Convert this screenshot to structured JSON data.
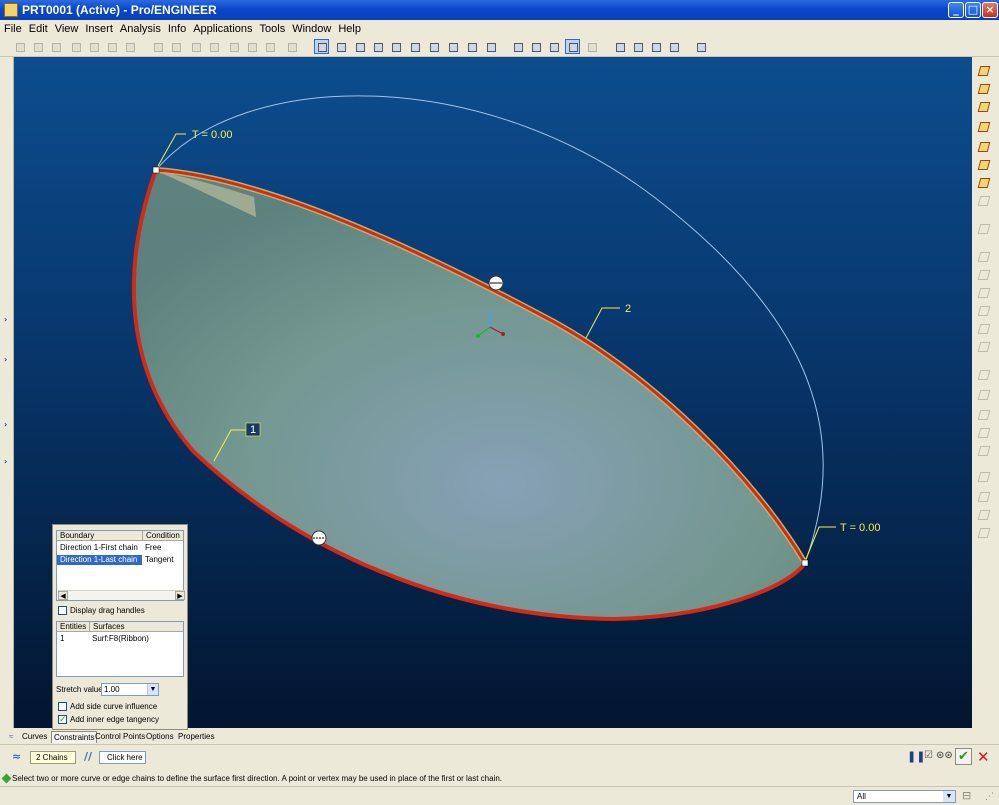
{
  "window": {
    "title": "PRT0001 (Active) - Pro/ENGINEER"
  },
  "menu": [
    "File",
    "Edit",
    "View",
    "Insert",
    "Analysis",
    "Info",
    "Applications",
    "Tools",
    "Window",
    "Help"
  ],
  "viewport": {
    "labels": {
      "t_start": "T = 0.00",
      "t_end": "T = 0.00",
      "chain_1": "1",
      "chain_2": "2"
    }
  },
  "panel": {
    "boundary_table": {
      "headers": [
        "Boundary",
        "Condition"
      ],
      "rows": [
        {
          "boundary": "Direction 1-First chain",
          "condition": "Free",
          "selected": false
        },
        {
          "boundary": "Direction 1-Last chain",
          "condition": "Tangent",
          "selected": true
        }
      ]
    },
    "display_drag_handles": {
      "label": "Display drag handles",
      "checked": false
    },
    "entities_table": {
      "headers": [
        "Entities",
        "Surfaces"
      ],
      "rows": [
        {
          "entity": "1",
          "surface": "Surf:F8(Ribbon)"
        }
      ]
    },
    "stretch": {
      "label": "Stretch value",
      "value": "1.00"
    },
    "side_curve": {
      "label": "Add side curve influence",
      "checked": false
    },
    "inner_edge": {
      "label": "Add inner edge tangency",
      "checked": true
    }
  },
  "tabs": [
    {
      "label": "Curves",
      "active": false
    },
    {
      "label": "Constraints",
      "active": true
    },
    {
      "label": "Control Points",
      "active": false
    },
    {
      "label": "Options",
      "active": false
    },
    {
      "label": "Properties",
      "active": false
    }
  ],
  "dashboard": {
    "chains": "2 Chains",
    "click_here": "Click here t"
  },
  "message": "Select two or more curve or edge chains to define the surface first direction. A point or vertex may be used in place of the first or last chain.",
  "status": {
    "filter": "All"
  },
  "colors": {
    "boundary_red": "#d32a16",
    "surface_fill": "#8fb3a4",
    "label_yellow": "#f2ef4a"
  }
}
